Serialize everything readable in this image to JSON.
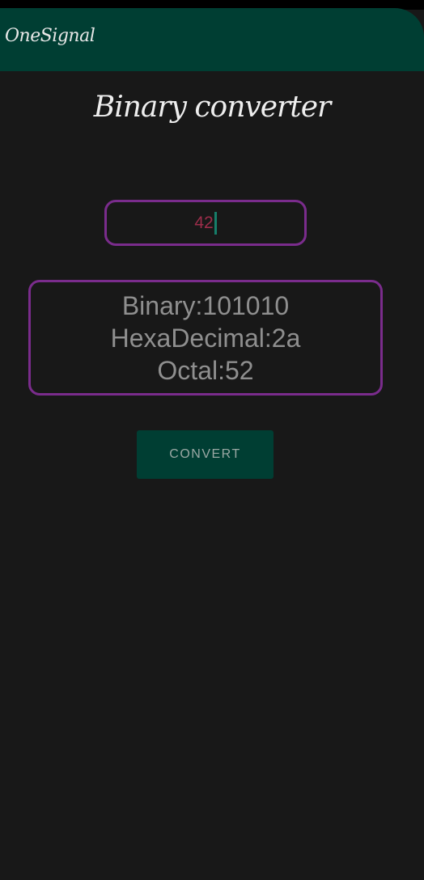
{
  "app_bar": {
    "title": "OneSignal"
  },
  "page": {
    "title": "Binary converter"
  },
  "input": {
    "value": "42"
  },
  "results": {
    "binary": "Binary:101010",
    "hex": "HexaDecimal:2a",
    "octal": "Octal:52"
  },
  "convert_button": {
    "label": "CONVERT"
  },
  "colors": {
    "background": "#181818",
    "app_bar": "#003e33",
    "border_accent": "#7a2c8c",
    "input_text": "#9c2d4a",
    "caret": "#167e6a",
    "result_text": "#8f8f8f"
  }
}
